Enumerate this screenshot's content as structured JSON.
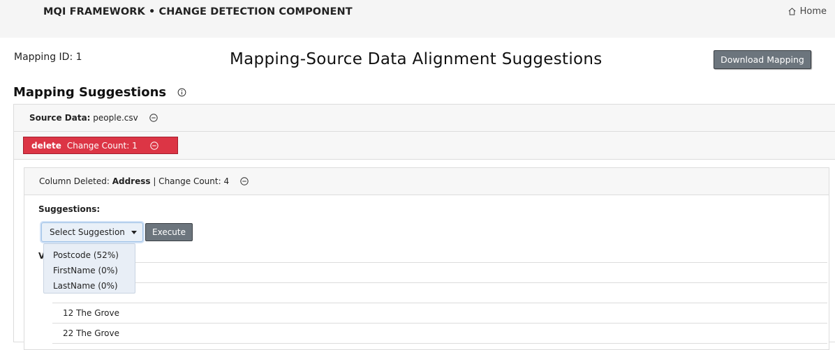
{
  "header": {
    "brand": "MQI FRAMEWORK • CHANGE DETECTION COMPONENT",
    "home_label": "Home",
    "home_icon": "home-icon"
  },
  "page": {
    "mapping_id": "Mapping ID: 1",
    "title": "Mapping-Source Data Alignment Suggestions",
    "download_label": "Download Mapping"
  },
  "section": {
    "title": "Mapping Suggestions",
    "info_icon": "info-icon"
  },
  "source": {
    "label": "Source Data:",
    "file": "people.csv"
  },
  "change": {
    "type": "delete",
    "count_text": "Change Count: 1",
    "color": "#dc3545"
  },
  "column": {
    "prefix": "Column Deleted:",
    "name": "Address",
    "count_text": "| Change Count: 4"
  },
  "suggestions": {
    "label": "Suggestions:",
    "select_label": "Select Suggestion",
    "execute_label": "Execute",
    "options": [
      "Postcode (52%)",
      "FirstName (0%)",
      "LastName (0%)"
    ]
  },
  "values": {
    "label_visible": "V",
    "rows": [
      "",
      "",
      "12 The Grove",
      "22 The Grove"
    ]
  },
  "colors": {
    "secondary_button": "#6c757d",
    "danger": "#dc3545"
  }
}
